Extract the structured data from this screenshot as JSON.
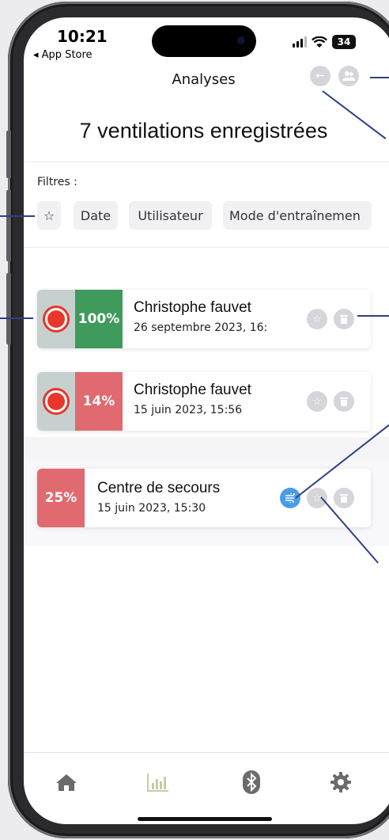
{
  "status": {
    "time": "10:21",
    "back_app": "◂ App Store",
    "battery": "34"
  },
  "header": {
    "title": "Analyses"
  },
  "summary": {
    "title": "7 ventilations enregistrées"
  },
  "filters": {
    "label": "Filtres :",
    "chips": [
      "☆",
      "Date",
      "Utilisateur",
      "Mode d'entraînemen"
    ]
  },
  "recordings": [
    {
      "percent": "100%",
      "percent_color": "#3f9a5c",
      "name": "Christophe fauvet",
      "date": "26 septembre 2023, 16:"
    },
    {
      "percent": "14%",
      "percent_color": "#e06a6f",
      "name": "Christophe fauvet",
      "date": "15 juin 2023, 15:56"
    },
    {
      "percent": "25%",
      "percent_color": "#e06a6f",
      "name": "Centre de secours",
      "date": "15 juin 2023, 15:30"
    }
  ],
  "colors": {
    "accent_annotation": "#2e3f86",
    "tab_active": "#c9cba3",
    "tab_inactive": "#6b6b6b",
    "info_icon": "#4b9ce8"
  },
  "tabs": [
    "home-icon",
    "chart-icon",
    "bluetooth-icon",
    "gear-icon"
  ]
}
